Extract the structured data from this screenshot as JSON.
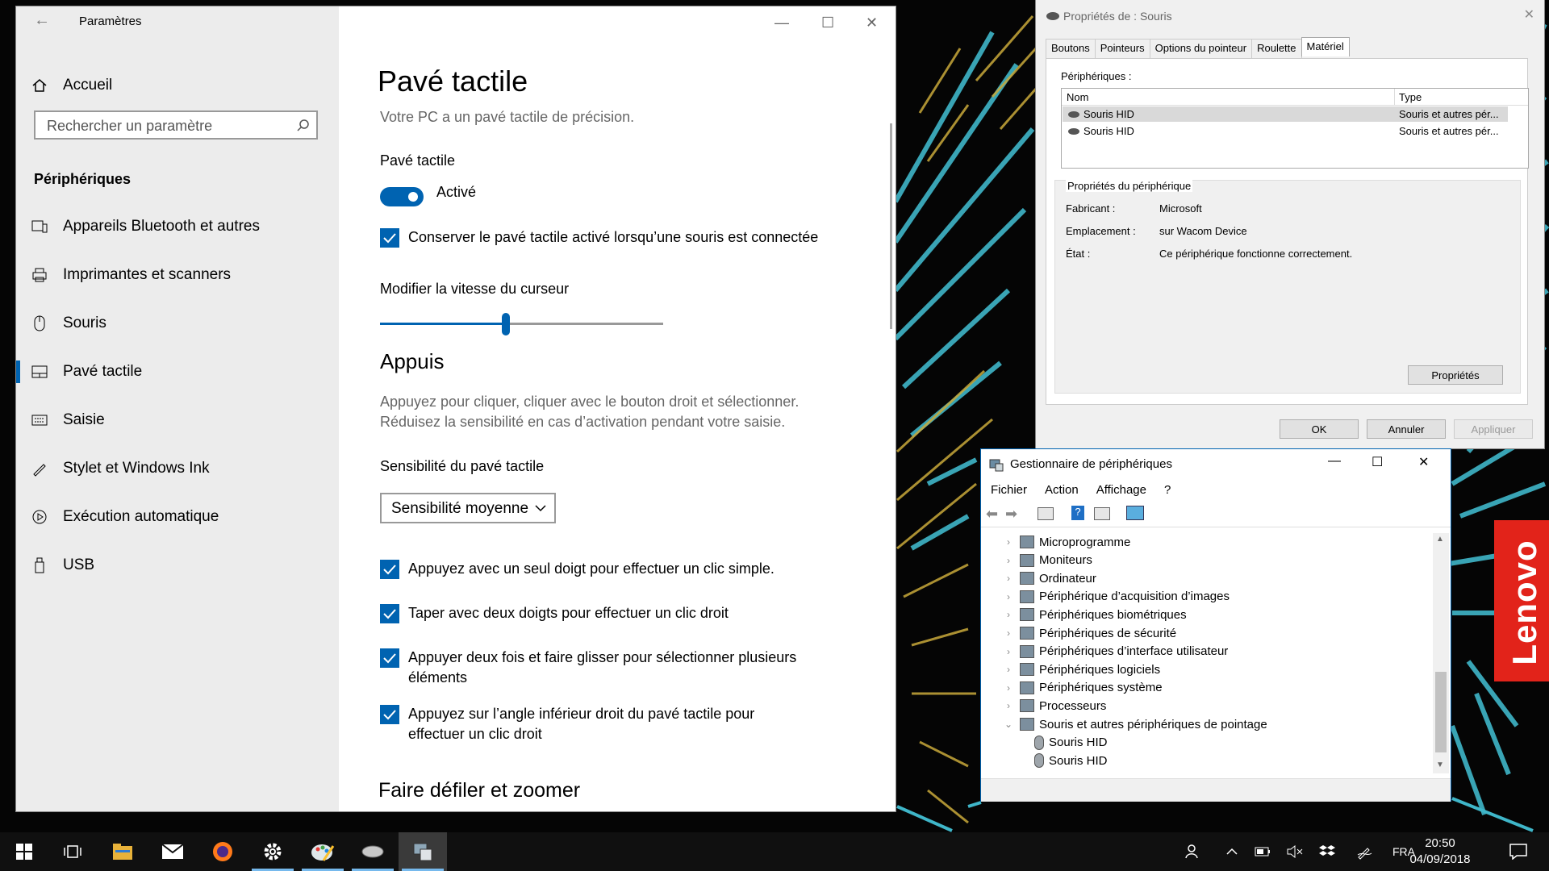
{
  "settings": {
    "app_title": "Paramètres",
    "home": "Accueil",
    "search_placeholder": "Rechercher un paramètre",
    "section": "Périphériques",
    "nav": [
      {
        "label": "Appareils Bluetooth et autres",
        "icon": "bluetooth-devices-icon"
      },
      {
        "label": "Imprimantes et scanners",
        "icon": "printer-icon"
      },
      {
        "label": "Souris",
        "icon": "mouse-icon"
      },
      {
        "label": "Pavé tactile",
        "icon": "touchpad-icon",
        "selected": true
      },
      {
        "label": "Saisie",
        "icon": "keyboard-icon"
      },
      {
        "label": "Stylet et Windows Ink",
        "icon": "pen-icon"
      },
      {
        "label": "Exécution automatique",
        "icon": "autoplay-icon"
      },
      {
        "label": "USB",
        "icon": "usb-icon"
      }
    ],
    "page_title": "Pavé tactile",
    "precision_note": "Votre PC a un pavé tactile de précision.",
    "touchpad_label": "Pavé tactile",
    "toggle_state": "Activé",
    "toggle_on": true,
    "keep_on_label": "Conserver le pavé tactile activé lorsqu’une souris est connectée",
    "cursor_speed_label": "Modifier la vitesse du curseur",
    "cursor_speed_value": 0.44,
    "taps_heading": "Appuis",
    "taps_desc1": "Appuyez pour cliquer, cliquer avec le bouton droit et sélectionner.",
    "taps_desc2": "Réduisez la sensibilité en cas d’activation pendant votre saisie.",
    "sensitivity_label": "Sensibilité du pavé tactile",
    "sensitivity_value": "Sensibilité moyenne",
    "tap_options": [
      {
        "line1": "Appuyez avec un seul doigt pour effectuer un clic simple.",
        "line2": "",
        "checked": true
      },
      {
        "line1": "Taper avec deux doigts pour effectuer un clic droit",
        "line2": "",
        "checked": true
      },
      {
        "line1": "Appuyer deux fois et faire glisser pour sélectionner plusieurs",
        "line2": "éléments",
        "checked": true
      },
      {
        "line1": "Appuyez sur l’angle inférieur droit du pavé tactile pour",
        "line2": "effectuer un clic droit",
        "checked": true
      }
    ],
    "scroll_heading": "Faire défiler et zoomer"
  },
  "mouseprops": {
    "title": "Propriétés de : Souris",
    "tabs": [
      "Boutons",
      "Pointeurs",
      "Options du pointeur",
      "Roulette",
      "Matériel"
    ],
    "active_tab": "Matériel",
    "devices_label": "Périphériques :",
    "columns": [
      "Nom",
      "Type"
    ],
    "rows": [
      {
        "name": "Souris HID",
        "type": "Souris et autres pér..."
      },
      {
        "name": "Souris HID",
        "type": "Souris et autres pér..."
      }
    ],
    "group_title": "Propriétés du périphérique",
    "props": [
      {
        "k": "Fabricant :",
        "v": "Microsoft"
      },
      {
        "k": "Emplacement :",
        "v": "sur Wacom Device"
      },
      {
        "k": "État :",
        "v": "Ce périphérique fonctionne correctement."
      }
    ],
    "properties_btn": "Propriétés",
    "ok": "OK",
    "cancel": "Annuler",
    "apply": "Appliquer"
  },
  "devmgr": {
    "title": "Gestionnaire de périphériques",
    "menu": [
      "Fichier",
      "Action",
      "Affichage",
      "?"
    ],
    "tree": [
      {
        "label": "Microprogramme",
        "expanded": false,
        "indent": 0
      },
      {
        "label": "Moniteurs",
        "expanded": false,
        "indent": 0
      },
      {
        "label": "Ordinateur",
        "expanded": false,
        "indent": 0
      },
      {
        "label": "Périphérique d’acquisition d’images",
        "expanded": false,
        "indent": 0
      },
      {
        "label": "Périphériques biométriques",
        "expanded": false,
        "indent": 0
      },
      {
        "label": "Périphériques de sécurité",
        "expanded": false,
        "indent": 0
      },
      {
        "label": "Périphériques d’interface utilisateur",
        "expanded": false,
        "indent": 0
      },
      {
        "label": "Périphériques logiciels",
        "expanded": false,
        "indent": 0
      },
      {
        "label": "Périphériques système",
        "expanded": false,
        "indent": 0
      },
      {
        "label": "Processeurs",
        "expanded": false,
        "indent": 0
      },
      {
        "label": "Souris et autres périphériques de pointage",
        "expanded": true,
        "indent": 0
      },
      {
        "label": "Souris HID",
        "expanded": null,
        "indent": 1
      },
      {
        "label": "Souris HID",
        "expanded": null,
        "indent": 1
      }
    ]
  },
  "taskbar": {
    "apps": [
      "start-icon",
      "task-view-icon",
      "file-explorer-icon",
      "mail-icon",
      "firefox-icon",
      "settings-icon",
      "paint-icon",
      "mouse-app-icon",
      "device-manager-icon"
    ],
    "language": "FRA",
    "time": "20:50",
    "date": "04/09/2018"
  },
  "desktop": {
    "brand": "Lenovo"
  },
  "colors": {
    "accent": "#0063b1",
    "taskbar": "#101010",
    "lenovo_red": "#e2231a",
    "leaf_cyan": "#3fb6c9",
    "leaf_gold": "#c9a93a"
  }
}
